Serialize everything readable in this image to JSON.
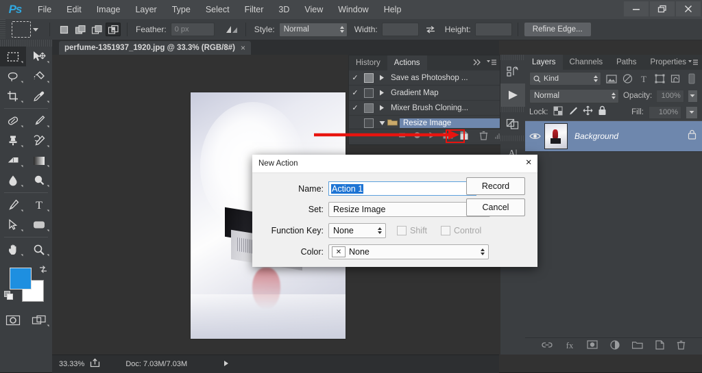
{
  "app": {
    "logo": "Ps",
    "menus": [
      "File",
      "Edit",
      "Image",
      "Layer",
      "Type",
      "Select",
      "Filter",
      "3D",
      "View",
      "Window",
      "Help"
    ],
    "window_controls": [
      "minimize",
      "restore",
      "close"
    ]
  },
  "options_bar": {
    "feather_label": "Feather:",
    "feather_value": "0 px",
    "style_label": "Style:",
    "style_value": "Normal",
    "width_label": "Width:",
    "width_value": "",
    "height_label": "Height:",
    "height_value": "",
    "refine_edge_label": "Refine Edge..."
  },
  "document": {
    "tab_title": "perfume-1351937_1920.jpg @ 33.3% (RGB/8#)",
    "close_glyph": "×"
  },
  "status_bar": {
    "zoom": "33.33%",
    "doc_info": "Doc: 7.03M/7.03M"
  },
  "actions_panel": {
    "tabs": [
      {
        "label": "History",
        "active": false
      },
      {
        "label": "Actions",
        "active": true
      }
    ],
    "rows": [
      {
        "name": "Save as Photoshop ...",
        "checked": true,
        "selected": false
      },
      {
        "name": "Gradient Map",
        "checked": true,
        "selected": false
      },
      {
        "name": "Mixer Brush Cloning...",
        "checked": true,
        "selected": false
      },
      {
        "name": "Resize Image",
        "checked": false,
        "selected": true
      }
    ],
    "footer_buttons": [
      "stop-button",
      "record-button",
      "play-button",
      "new-set-button",
      "new-action-button",
      "delete-button"
    ],
    "highlight_color": "#e8140f"
  },
  "layers_panel": {
    "tabs": [
      {
        "label": "Layers",
        "active": true
      },
      {
        "label": "Channels",
        "active": false
      },
      {
        "label": "Paths",
        "active": false
      },
      {
        "label": "Properties",
        "active": false
      }
    ],
    "filter_value": "Kind",
    "blend_mode": "Normal",
    "opacity_label": "Opacity:",
    "opacity_value": "100%",
    "lock_label": "Lock:",
    "fill_label": "Fill:",
    "fill_value": "100%",
    "layer": {
      "name": "Background",
      "visible": true,
      "locked": true
    }
  },
  "dialog": {
    "title": "New Action",
    "close_glyph": "✕",
    "name_label": "Name:",
    "name_value": "Action 1",
    "set_label": "Set:",
    "set_value": "Resize Image",
    "function_key_label": "Function Key:",
    "function_key_value": "None",
    "shift_label": "Shift",
    "control_label": "Control",
    "color_label": "Color:",
    "color_value": "None",
    "color_swatch_glyph": "✕",
    "record_label": "Record",
    "cancel_label": "Cancel"
  },
  "toolbar": {
    "tools": [
      "rectangular-marquee-tool",
      "move-tool",
      "lasso-tool",
      "quick-selection-tool",
      "crop-tool",
      "eyedropper-tool",
      "healing-brush-tool",
      "brush-tool",
      "clone-stamp-tool",
      "history-brush-tool",
      "eraser-tool",
      "gradient-tool",
      "blur-tool",
      "dodge-tool",
      "pen-tool",
      "type-tool",
      "path-selection-tool",
      "shape-tool",
      "hand-tool",
      "zoom-tool"
    ],
    "foreground_color": "#1e8fe0",
    "background_color": "#ffffff"
  },
  "theme": {
    "panel_bg": "#3b3e41",
    "menu_bg": "#44474a",
    "canvas_bg": "#323232",
    "selection_blue": "#6e87ad",
    "accent_blue": "#31a8e0"
  }
}
